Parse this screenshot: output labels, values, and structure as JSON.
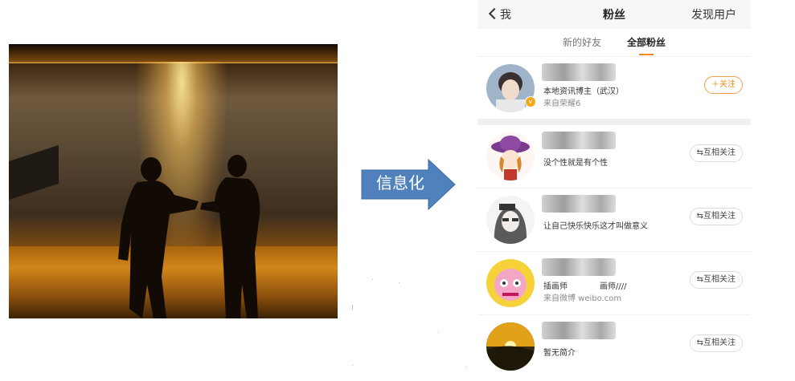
{
  "arrow": {
    "label": "信息化",
    "color": "#4f81bd"
  },
  "nav": {
    "back_label": "我",
    "title": "粉丝",
    "right_action": "发现用户"
  },
  "tabs": [
    {
      "label": "新的好友",
      "active": false
    },
    {
      "label": "全部粉丝",
      "active": true
    }
  ],
  "fans": [
    {
      "description": "本地资讯博主（武汉）",
      "source": "来自荣耀6",
      "button": "＋关注",
      "avatar_icon": "boy-portrait",
      "verified": true
    },
    {
      "description": "没个性就是有个性",
      "source": "",
      "button": "⇆互相关注",
      "avatar_icon": "cartoon-girl-hat"
    },
    {
      "description": "让自己快乐快乐这才叫做意义",
      "source": "",
      "button": "⇆互相关注",
      "avatar_icon": "sketch-girl"
    },
    {
      "description": "插画师　　　　画师////",
      "source": "来自微博 weibo.com",
      "button": "⇆互相关注",
      "avatar_icon": "pink-cartoon"
    },
    {
      "description": "暂无简介",
      "source": "",
      "button": "⇆互相关注",
      "avatar_icon": "sunset-landscape"
    }
  ],
  "accent_color": "#f08a1e"
}
